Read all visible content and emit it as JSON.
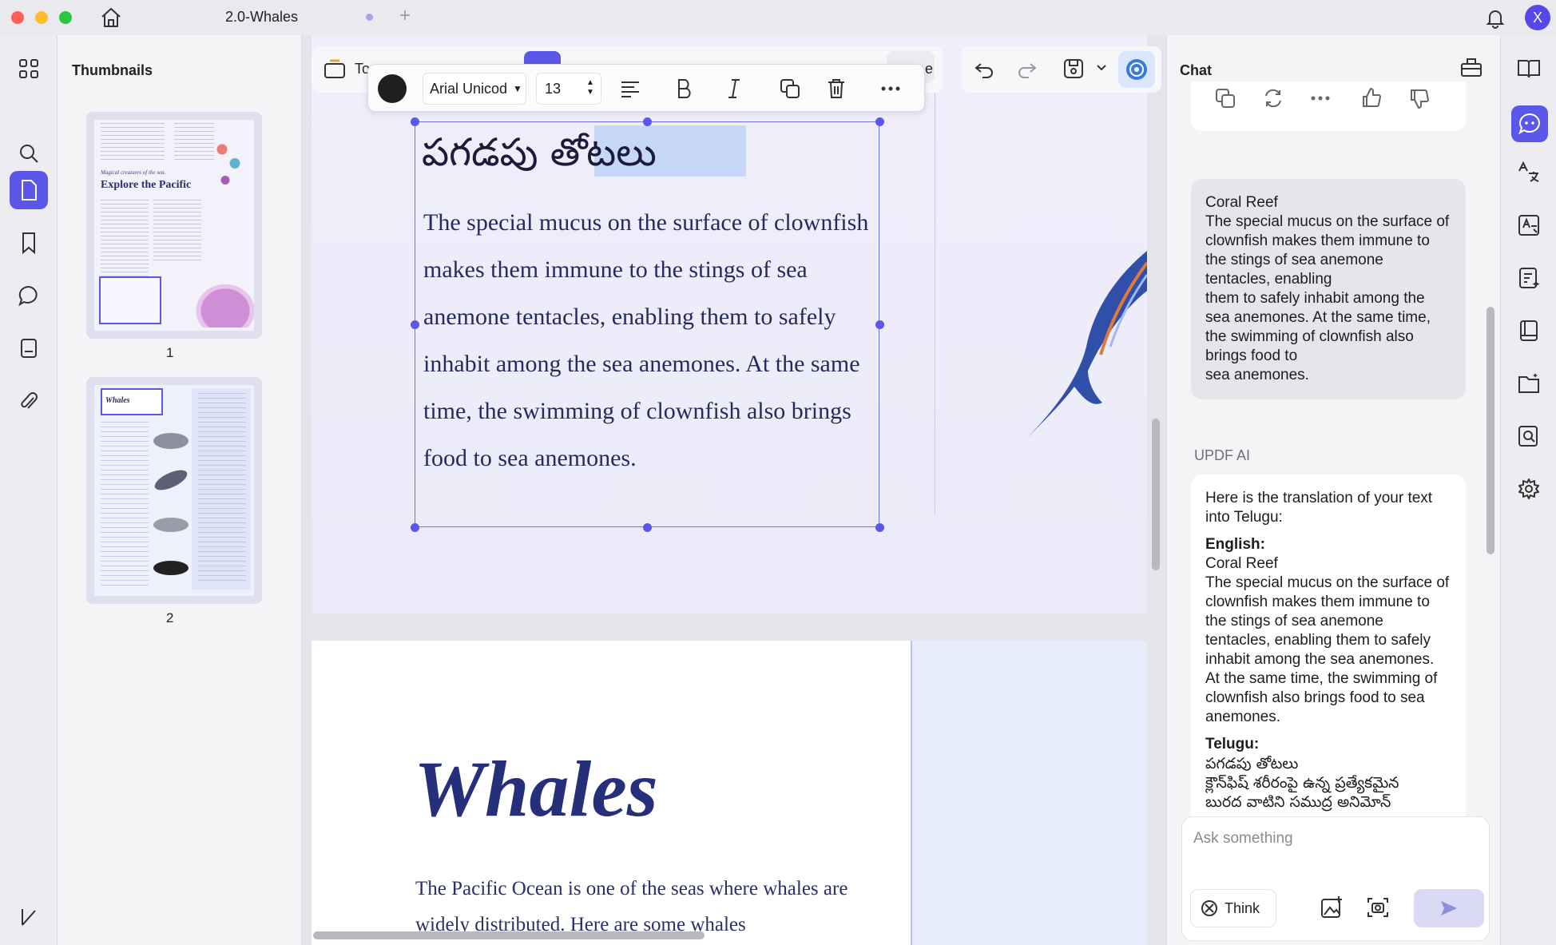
{
  "window": {
    "tab_title": "2.0-Whales",
    "new_tab": "+",
    "avatar_letter": "X"
  },
  "thumbnails": {
    "title": "Thumbnails",
    "pages": [
      {
        "num": "1",
        "mini_subtitle": "Magical creatures of the sea.",
        "mini_title": "Explore the Pacific"
      },
      {
        "num": "2",
        "mini_title": "Whales"
      }
    ]
  },
  "toolbar": {
    "partial_label": "To",
    "partial_right": "e"
  },
  "format_bar": {
    "color": "#1f1f1f",
    "font": "Arial Unicod",
    "size": "13"
  },
  "textbox": {
    "heading": "పగడపు తోటలు",
    "body": "The special mucus on the surface of clownfish makes them immune to the stings of sea anemone tentacles, enabling them to safely inhabit among the sea anemones. At the same time, the swimming of clownfish also brings food to sea anemones."
  },
  "page2": {
    "title": "Whales",
    "body": "The Pacific Ocean is one of the seas where whales are widely distributed. Here are some whales"
  },
  "chat": {
    "title": "Chat",
    "user_message": "Coral Reef\nThe special mucus on the surface of clownfish makes them immune to the stings of sea anemone tentacles, enabling\nthem to safely inhabit among the sea anemones. At the same time, the swimming of clownfish also brings food to\nsea anemones.",
    "ai_label": "UPDF AI",
    "ai_intro": "Here is the translation of your text into Telugu:",
    "ai_english_label": "English:",
    "ai_english": "Coral Reef\nThe special mucus on the surface of clownfish makes them immune to the stings of sea anemone tentacles, enabling them to safely inhabit among the sea anemones. At the same time, the swimming of clownfish also brings food to sea anemones.",
    "ai_telugu_label": "Telugu:",
    "ai_telugu": "పగడపు తోటలు\nక్లౌన్‌ఫిష్ శరీరంపై ఉన్న ప్రత్యేకమైన\nబురద వాటిని సముద్ర అనిమోన్",
    "ask_placeholder": "Ask something",
    "think_label": "Think"
  },
  "colors": {
    "accent": "#5b57e8",
    "text_dark_blue": "#252b5c",
    "selection": "#c6d7f7"
  }
}
